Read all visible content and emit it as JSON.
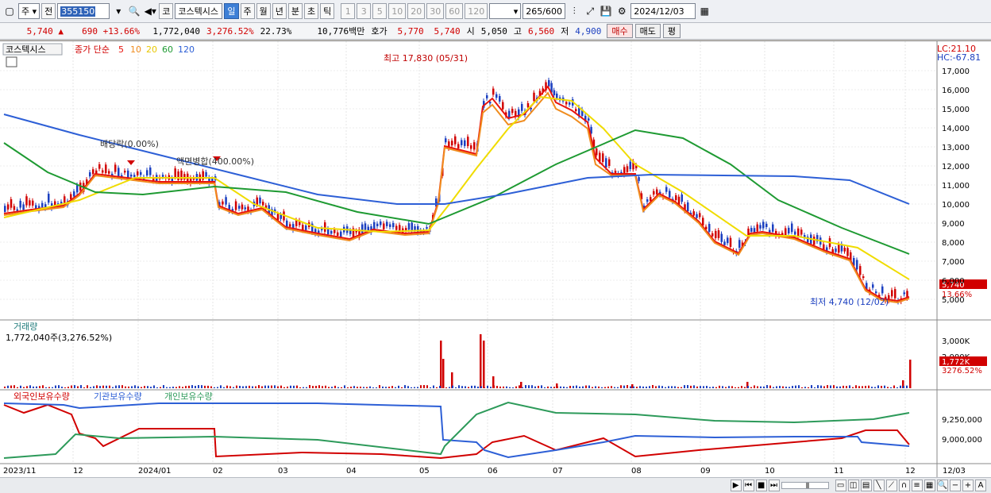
{
  "toolbar": {
    "type_label": "주",
    "prev_label": "전",
    "code_value": "355150",
    "speaker_label": "◀",
    "kosdaq_label": "코",
    "stock_name": "코스텍시스",
    "periods": [
      "일",
      "주",
      "월",
      "년",
      "분",
      "초",
      "틱"
    ],
    "selected_period": "일",
    "intervals": [
      "1",
      "3",
      "5",
      "10",
      "20",
      "30",
      "60",
      "120"
    ],
    "count": "265",
    "count_max": "/600",
    "date": "2024/12/03"
  },
  "quote": {
    "price": "5,740",
    "arrow": "▲",
    "change": "690",
    "change_pct": "+13.66%",
    "volume": "1,772,040",
    "volume_pct": "3,276.52%",
    "turnover": "22.73%",
    "amount": "10,776백만",
    "hoga_label": "호가",
    "hoga_ask": "5,770",
    "hoga_bid": "5,740",
    "open_label": "시",
    "open": "5,050",
    "high_label": "고",
    "high": "6,560",
    "low_label": "저",
    "low": "4,900",
    "buy_label": "매수",
    "sell_label": "매도",
    "avg_label": "평"
  },
  "price_panel": {
    "title": "코스텍시스",
    "ma_label": "종가 단순",
    "ma_periods": [
      "5",
      "10",
      "20",
      "60",
      "120"
    ],
    "lc": "LC:21.10",
    "hc": "HC:-67.81",
    "high_annot": "최고 17,830 (05/31)",
    "low_annot": "최저 4,740 (12/02)",
    "dividend_annot": "배당락(0.00%)",
    "split_annot": "액면병합(400.00%)",
    "price_tag": "5,740",
    "pct_tag": "13.66%",
    "y_labels": [
      "17,000",
      "16,000",
      "15,000",
      "14,000",
      "13,000",
      "12,000",
      "11,000",
      "10,000",
      "9,000",
      "8,000",
      "7,000",
      "6,000",
      "5,000"
    ]
  },
  "volume_panel": {
    "title": "거래량",
    "value": "1,772,040주(3,276.52%)",
    "y_labels": [
      "3,000K",
      "2,000K"
    ],
    "tag": "1,772K",
    "tag_pct": "3276.52%"
  },
  "holding_panel": {
    "legend": [
      "외국인보유수량",
      "기관보유수량",
      "개인보유수량"
    ],
    "y_labels": [
      "9,250,000",
      "9,000,000"
    ]
  },
  "x_axis": [
    "2023/11",
    "12",
    "2024/01",
    "02",
    "03",
    "04",
    "05",
    "06",
    "07",
    "08",
    "09",
    "10",
    "11",
    "12",
    "12/03"
  ],
  "colors": {
    "up": "#d10000",
    "down": "#1b3fc0",
    "ma5": "#e8130d",
    "ma10": "#f08c1e",
    "ma20": "#f5e200",
    "ma60": "#1e9a32",
    "ma120": "#2d5fd6",
    "foreign": "#d10000",
    "institution": "#2d5fd6",
    "individual": "#2d9a5a"
  }
}
